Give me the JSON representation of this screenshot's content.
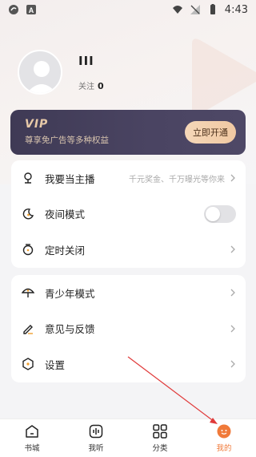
{
  "status_bar": {
    "time": "4:43"
  },
  "profile": {
    "username": "III",
    "follow_label": "关注",
    "follow_count": "0"
  },
  "vip": {
    "logo": "VIP",
    "text": "尊享免广告等多种权益",
    "button": "立即开通"
  },
  "menu_group1": [
    {
      "label": "我要当主播",
      "hint": "千元奖金、千万曝光等你来",
      "icon": "anchor-icon"
    },
    {
      "label": "夜间模式",
      "icon": "moon-icon",
      "toggle_on": false
    },
    {
      "label": "定时关闭",
      "icon": "timer-icon"
    }
  ],
  "menu_group2": [
    {
      "label": "青少年模式",
      "icon": "umbrella-icon"
    },
    {
      "label": "意见与反馈",
      "icon": "pen-icon"
    },
    {
      "label": "设置",
      "icon": "settings-icon"
    }
  ],
  "bottom_nav": [
    {
      "label": "书城",
      "icon": "bookstore-icon"
    },
    {
      "label": "我听",
      "icon": "listen-icon"
    },
    {
      "label": "分类",
      "icon": "category-icon"
    },
    {
      "label": "我的",
      "icon": "profile-icon",
      "active": true
    }
  ],
  "colors": {
    "accent": "#f07a3a",
    "vip_gold": "#e7c9a8",
    "vip_bg": "#433e5a",
    "arrow": "#e03a3a"
  }
}
